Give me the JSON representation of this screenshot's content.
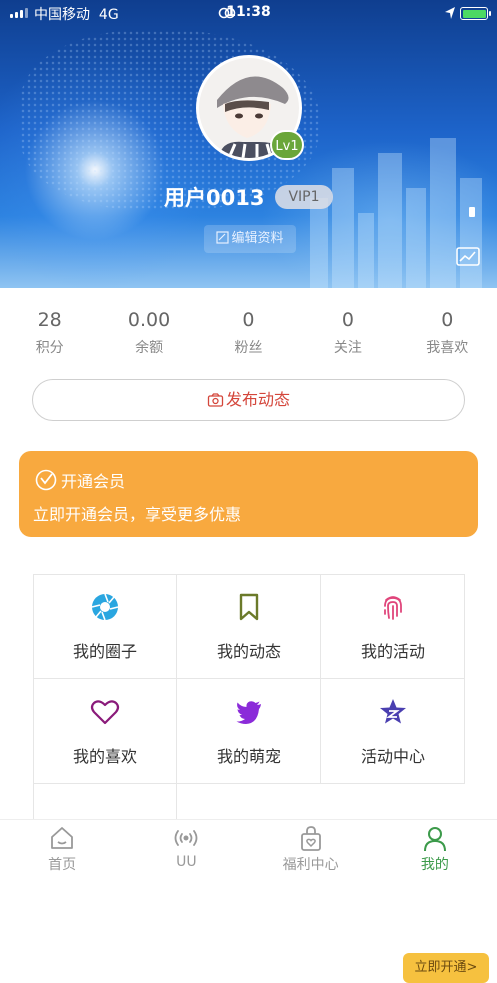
{
  "status_bar": {
    "carrier": "中国移动",
    "network": "4G",
    "time": "11:38",
    "icons": [
      "signal-icon",
      "link-icon",
      "location-icon",
      "battery-charging-icon"
    ]
  },
  "profile": {
    "level": "Lv1",
    "username": "用户0013",
    "vip_badge": "VIP1",
    "edit_label": "编辑资料"
  },
  "stats": [
    {
      "value": "28",
      "label": "积分"
    },
    {
      "value": "0.00",
      "label": "余额"
    },
    {
      "value": "0",
      "label": "粉丝"
    },
    {
      "value": "0",
      "label": "关注"
    },
    {
      "value": "0",
      "label": "我喜欢"
    }
  ],
  "publish_label": "发布动态",
  "membership": {
    "title": "开通会员",
    "subtitle": "立即开通会员，享受更多优惠",
    "button": "立即开通>",
    "color": "#f8a93f"
  },
  "menu": [
    {
      "label": "我的圈子",
      "icon": "aperture-icon",
      "color": "#2aa6e0"
    },
    {
      "label": "我的动态",
      "icon": "bookmark-icon",
      "color": "#6b7a2a"
    },
    {
      "label": "我的活动",
      "icon": "fingerprint-icon",
      "color": "#e0457b"
    },
    {
      "label": "我的喜欢",
      "icon": "heart-icon",
      "color": "#8a1a7a"
    },
    {
      "label": "我的萌宠",
      "icon": "twitter-bird-icon",
      "color": "#8b2bd9"
    },
    {
      "label": "活动中心",
      "icon": "star-badge-icon",
      "color": "#4a3fb0"
    }
  ],
  "tabs": [
    {
      "label": "首页",
      "icon": "home-icon"
    },
    {
      "label": "UU",
      "icon": "broadcast-icon"
    },
    {
      "label": "福利中心",
      "icon": "gift-bag-icon"
    },
    {
      "label": "我的",
      "icon": "user-icon",
      "active": true
    }
  ],
  "accent_color": "#3c9a4a"
}
